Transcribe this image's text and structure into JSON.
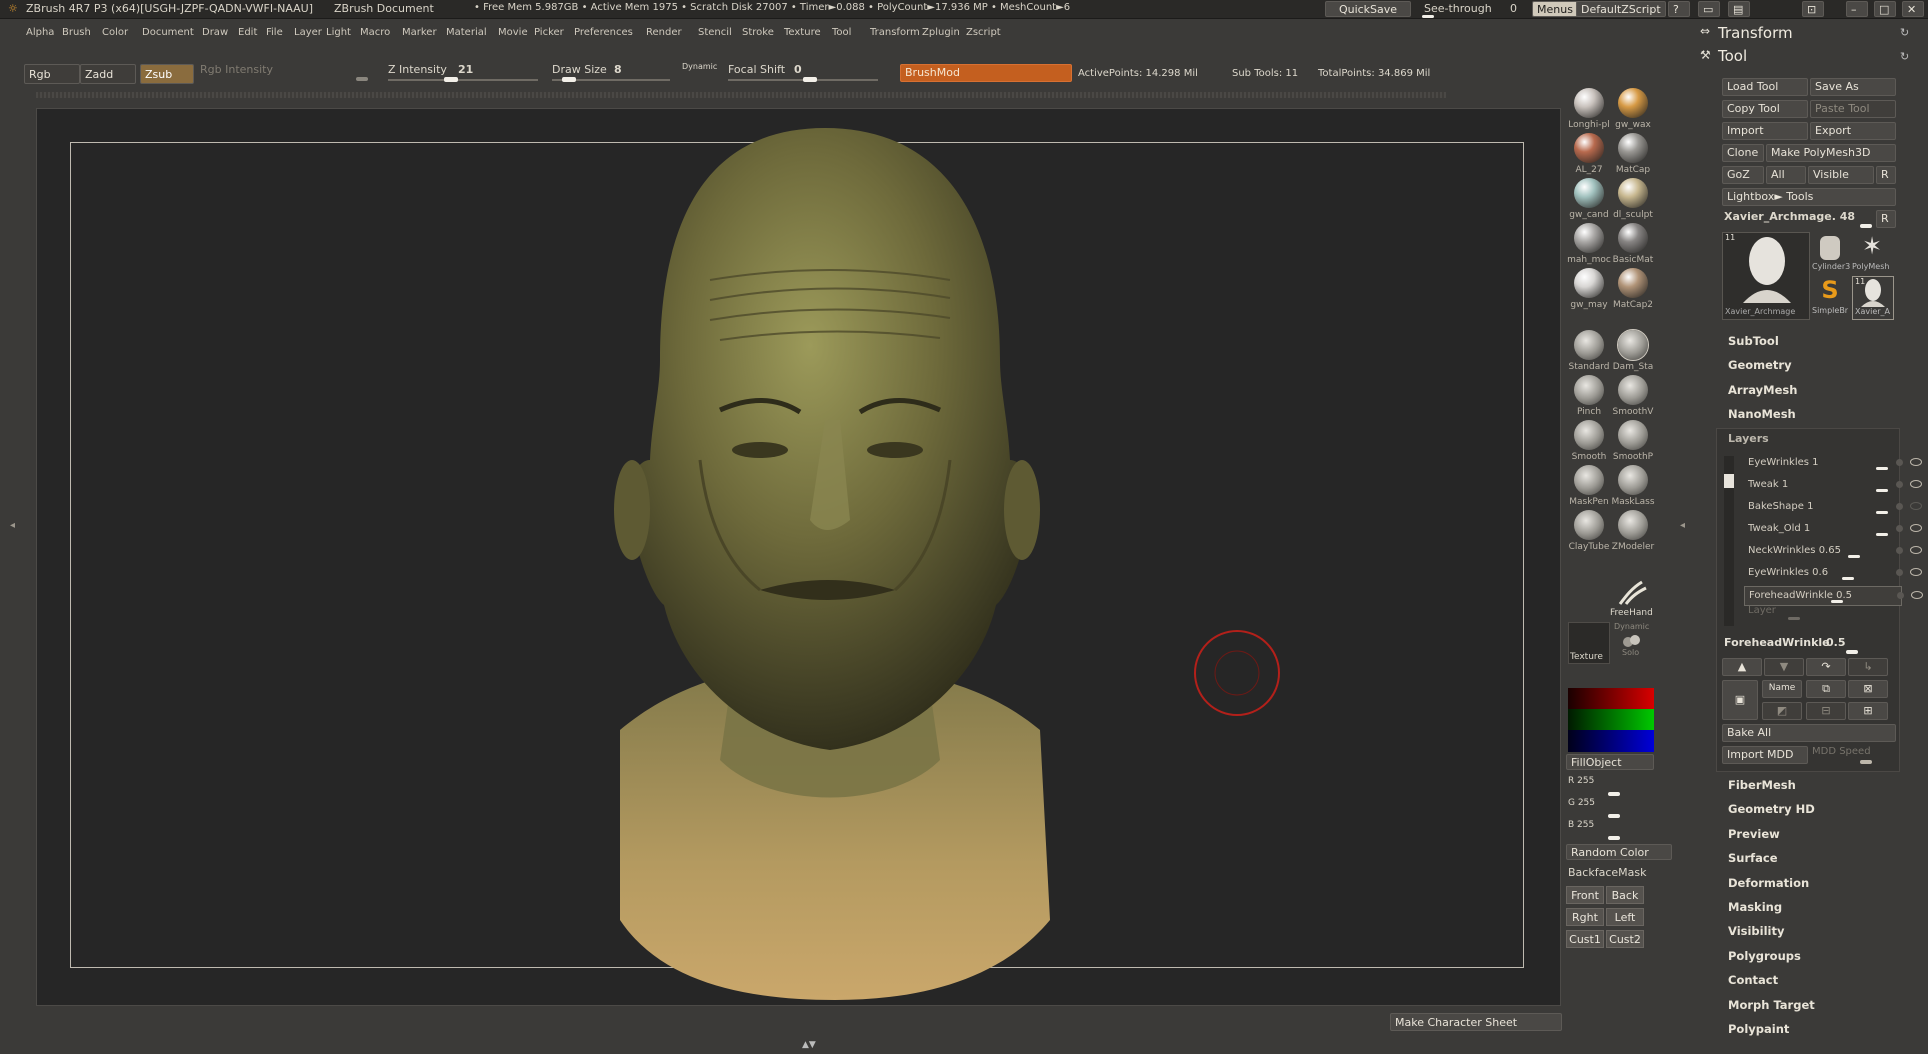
{
  "title_bar": {
    "app": "ZBrush 4R7 P3 (x64)[USGH-JZPF-QADN-VWFI-NAAU]",
    "doc": "ZBrush Document",
    "stats": "• Free Mem 5.987GB • Active Mem 1975 • Scratch Disk 27007 • Timer►0.088 • PolyCount►17.936 MP • MeshCount►6",
    "quicksave": "QuickSave",
    "see_through": "See-through",
    "see_through_value": "0",
    "menus": "Menus",
    "script": "DefaultZScript"
  },
  "menus": [
    "Alpha",
    "Brush",
    "Color",
    "Document",
    "Draw",
    "Edit",
    "File",
    "Layer",
    "Light",
    "Macro",
    "Marker",
    "Material",
    "Movie",
    "Picker",
    "Preferences",
    "Render",
    "Stencil",
    "Stroke",
    "Texture",
    "Tool",
    "Transform",
    "Zplugin",
    "Zscript"
  ],
  "tool_bar": {
    "rgb": "Rgb",
    "zadd": "Zadd",
    "zsub": "Zsub",
    "rgb_intensity": "Rgb Intensity",
    "z_intensity_label": "Z Intensity",
    "z_intensity": "21",
    "draw_size_label": "Draw Size",
    "draw_size": "8",
    "dynamic": "Dynamic",
    "focal_shift_label": "Focal Shift",
    "focal_shift": "0",
    "brush_name": "BrushMod",
    "active_points": "ActivePoints: 14.298 Mil",
    "sub_tools": "Sub Tools: 11",
    "total_points": "TotalPoints: 34.869 Mil"
  },
  "materials": [
    {
      "name": "Longhi-pl",
      "color": "#c9c2bd"
    },
    {
      "name": "gw_wax",
      "color": "#d79a45"
    },
    {
      "name": "AL_27",
      "color": "#b86a4e"
    },
    {
      "name": "MatCap",
      "color": "#9a9894"
    },
    {
      "name": "gw_cand",
      "color": "#a2c2bf"
    },
    {
      "name": "dl_sculpt",
      "color": "#c8b890"
    },
    {
      "name": "mah_moc",
      "color": "#aaa8a6"
    },
    {
      "name": "BasicMat",
      "color": "#888584"
    },
    {
      "name": "gw_may",
      "color": "#d8d6d4"
    },
    {
      "name": "MatCap2",
      "color": "#b19478"
    }
  ],
  "brushes": [
    "Standard",
    "Dam_Sta",
    "Pinch",
    "SmoothV",
    "Smooth",
    "SmoothP",
    "MaskPen",
    "MaskLass",
    "ClayTube",
    "ZModeler"
  ],
  "stroke": "FreeHand",
  "texture_label": "Texture",
  "dynamic_solo": {
    "top": "Dynamic",
    "bottom": "Solo"
  },
  "color_picker": {
    "fill_object": "FillObject",
    "r": "R 255",
    "g": "G 255",
    "b": "B 255"
  },
  "random_color": "Random Color",
  "backface_mask": "BackfaceMask",
  "views": [
    "Front",
    "Back",
    "Rght",
    "Left",
    "Cust1",
    "Cust2"
  ],
  "make_sheet": "Make Character Sheet",
  "right_panel": {
    "transform": "Transform",
    "tool": "Tool",
    "buttons": {
      "load_tool": "Load Tool",
      "save_as": "Save As",
      "copy_tool": "Copy Tool",
      "paste_tool": "Paste Tool",
      "import": "Import",
      "export": "Export",
      "clone": "Clone",
      "make_polymesh": "Make PolyMesh3D",
      "goz": "GoZ",
      "all": "All",
      "visible": "Visible",
      "r": "R",
      "lightbox_tools": "Lightbox► Tools"
    },
    "current_tool": "Xavier_Archmage. 48",
    "thumbs": [
      "Xavier_Archmage",
      "Cylinder3",
      "PolyMesh",
      "SimpleBr",
      "Xavier_A"
    ],
    "thumb_count_a": "11",
    "thumb_count_b": "11",
    "sections_top": [
      "SubTool",
      "Geometry",
      "ArrayMesh",
      "NanoMesh"
    ],
    "layers_title": "Layers",
    "layers": [
      {
        "name": "EyeWrinkles 1",
        "visible": true
      },
      {
        "name": "Tweak 1",
        "visible": true
      },
      {
        "name": "BakeShape 1",
        "visible": false
      },
      {
        "name": "Tweak_Old 1",
        "visible": true
      },
      {
        "name": "NeckWrinkles 0.65",
        "visible": true
      },
      {
        "name": "EyeWrinkles 0.6",
        "visible": true
      },
      {
        "name": "ForeheadWrinkle 0.5",
        "visible": true
      }
    ],
    "layer_placeholder": "Layer",
    "selected_layer": "ForeheadWrinkle",
    "selected_layer_value": "0.5",
    "name_btn": "Name",
    "bake_all": "Bake All",
    "import_mdd": "Import MDD",
    "mdd_speed": "MDD Speed",
    "sections_bottom": [
      "FiberMesh",
      "Geometry HD",
      "Preview",
      "Surface",
      "Deformation",
      "Masking",
      "Visibility",
      "Polygroups",
      "Contact",
      "Morph Target",
      "Polypaint"
    ]
  }
}
